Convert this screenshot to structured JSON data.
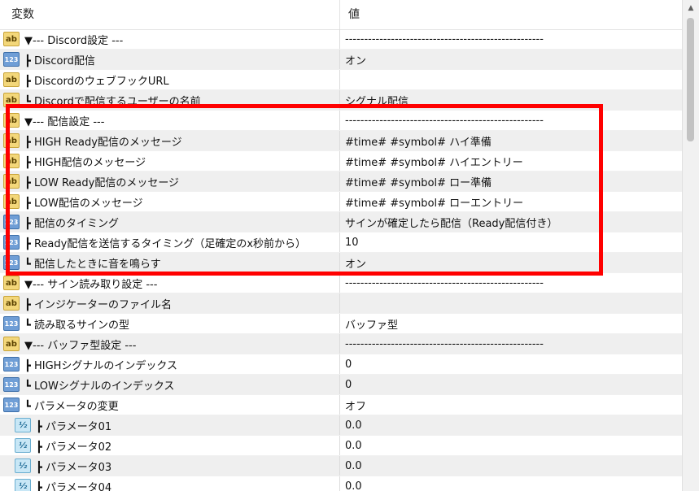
{
  "header": {
    "col_variable": "変数",
    "col_value": "値"
  },
  "rows": [
    {
      "icon": "ab",
      "indent": 0,
      "name": "▼--- Discord設定 ---",
      "value": "----------------------------------------------------",
      "shade": false
    },
    {
      "icon": "123",
      "indent": 0,
      "name": "┣ Discord配信",
      "value": "オン",
      "shade": true
    },
    {
      "icon": "ab",
      "indent": 0,
      "name": "┣ DiscordのウェブフックURL",
      "value": "",
      "shade": false
    },
    {
      "icon": "ab",
      "indent": 0,
      "name": "┗ Discordで配信するユーザーの名前",
      "value": "シグナル配信",
      "shade": true
    },
    {
      "icon": "ab",
      "indent": 0,
      "name": "▼--- 配信設定 ---",
      "value": "----------------------------------------------------",
      "shade": false
    },
    {
      "icon": "ab",
      "indent": 0,
      "name": "┣ HIGH Ready配信のメッセージ",
      "value": "#time# #symbol# ハイ準備",
      "shade": true
    },
    {
      "icon": "ab",
      "indent": 0,
      "name": "┣ HIGH配信のメッセージ",
      "value": "#time# #symbol# ハイエントリー",
      "shade": false
    },
    {
      "icon": "ab",
      "indent": 0,
      "name": "┣ LOW Ready配信のメッセージ",
      "value": "#time# #symbol# ロー準備",
      "shade": true
    },
    {
      "icon": "ab",
      "indent": 0,
      "name": "┣ LOW配信のメッセージ",
      "value": "#time# #symbol# ローエントリー",
      "shade": false
    },
    {
      "icon": "123",
      "indent": 0,
      "name": "┣ 配信のタイミング",
      "value": "サインが確定したら配信（Ready配信付き）",
      "shade": true
    },
    {
      "icon": "123",
      "indent": 0,
      "name": "┣ Ready配信を送信するタイミング（足確定のx秒前から）",
      "value": "10",
      "shade": false
    },
    {
      "icon": "123",
      "indent": 0,
      "name": "┗ 配信したときに音を鳴らす",
      "value": "オン",
      "shade": true
    },
    {
      "icon": "ab",
      "indent": 0,
      "name": "▼--- サイン読み取り設定 ---",
      "value": "----------------------------------------------------",
      "shade": false
    },
    {
      "icon": "ab",
      "indent": 0,
      "name": "┣ インジケーターのファイル名",
      "value": "",
      "shade": true
    },
    {
      "icon": "123",
      "indent": 0,
      "name": "┗ 読み取るサインの型",
      "value": "バッファ型",
      "shade": false
    },
    {
      "icon": "ab",
      "indent": 0,
      "name": "▼--- バッファ型設定 ---",
      "value": "----------------------------------------------------",
      "shade": true
    },
    {
      "icon": "123",
      "indent": 0,
      "name": "┣ HIGHシグナルのインデックス",
      "value": "0",
      "shade": false
    },
    {
      "icon": "123",
      "indent": 0,
      "name": "┗ LOWシグナルのインデックス",
      "value": "0",
      "shade": true
    },
    {
      "icon": "123",
      "indent": 0,
      "name": "┗ パラメータの変更",
      "value": "オフ",
      "shade": false
    },
    {
      "icon": "half",
      "indent": 1,
      "name": "┣ パラメータ01",
      "value": "0.0",
      "shade": true
    },
    {
      "icon": "half",
      "indent": 1,
      "name": "┣ パラメータ02",
      "value": "0.0",
      "shade": false
    },
    {
      "icon": "half",
      "indent": 1,
      "name": "┣ パラメータ03",
      "value": "0.0",
      "shade": true
    },
    {
      "icon": "half",
      "indent": 1,
      "name": "┣ パラメータ04",
      "value": "0.0",
      "shade": false
    }
  ],
  "icon_labels": {
    "ab": "ab",
    "123": "123",
    "half": "½"
  },
  "colors": {
    "highlight": "#ff0000",
    "row_shade": "#efefef"
  }
}
